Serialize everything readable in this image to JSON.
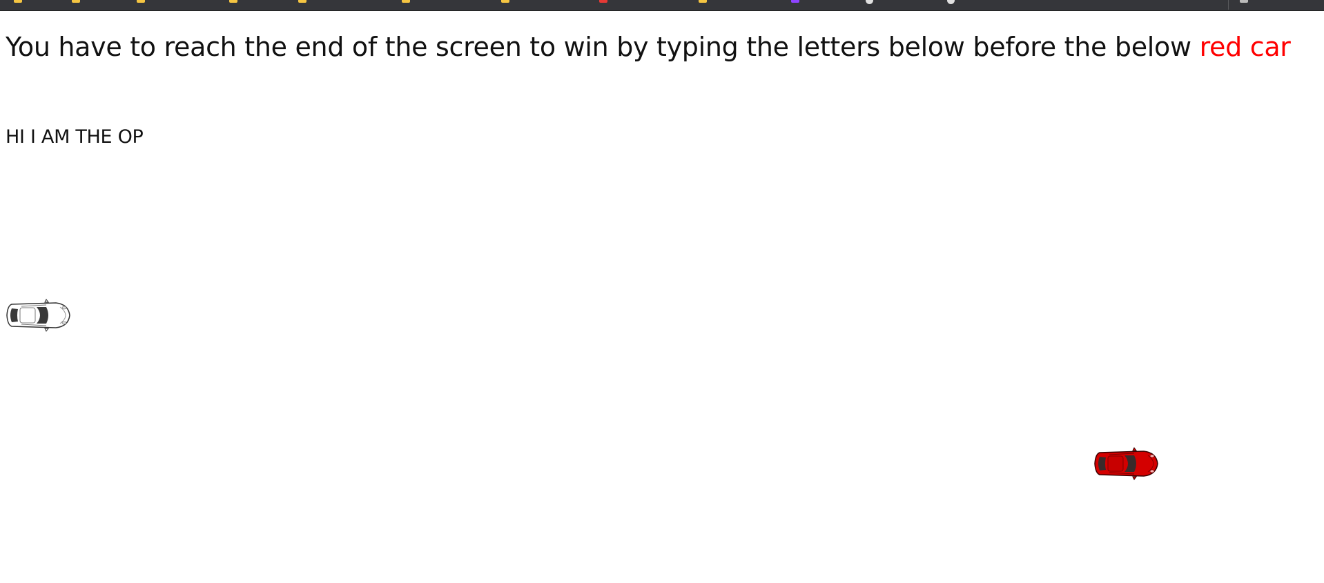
{
  "headline": {
    "text": "You have to reach the end of the screen to win by typing the letters below before the below ",
    "highlight": "red car",
    "highlight_color": "#ff0000"
  },
  "typing_target": "HI I AM THE OP",
  "cars": {
    "player": {
      "color": "white",
      "icon": "white-car-icon"
    },
    "opponent": {
      "color": "red",
      "icon": "red-car-icon"
    }
  },
  "browser": {
    "bookmarks_bar_color": "#35363a"
  }
}
